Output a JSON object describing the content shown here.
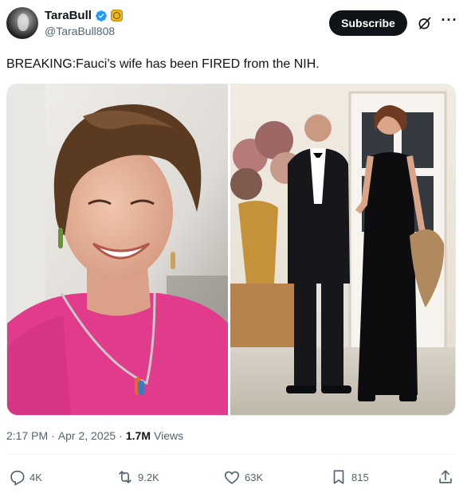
{
  "author": {
    "display_name": "TaraBull",
    "handle": "@TaraBull808",
    "avatar_icon": "profile-avatar",
    "verified_icon": "verified-badge-icon",
    "affiliate_icon": "gold-badge-icon"
  },
  "header": {
    "subscribe_label": "Subscribe",
    "grok_icon": "grok-icon",
    "more_icon": "more-options-icon",
    "more_glyph": "···"
  },
  "tweet": {
    "text": "BREAKING:Fauci’s wife has been FIRED from the NIH."
  },
  "meta": {
    "time": "2:17 PM",
    "sep1": "·",
    "date": "Apr 2, 2025",
    "sep2": "·",
    "views_count": "1.7M",
    "views_label": "Views"
  },
  "actions": {
    "replies": "4K",
    "reposts": "9.2K",
    "likes": "63K",
    "bookmarks": "815"
  },
  "colors": {
    "accent": "#1d9bf0",
    "text": "#0f1419",
    "muted": "#536471",
    "gold": "#e8b523"
  }
}
